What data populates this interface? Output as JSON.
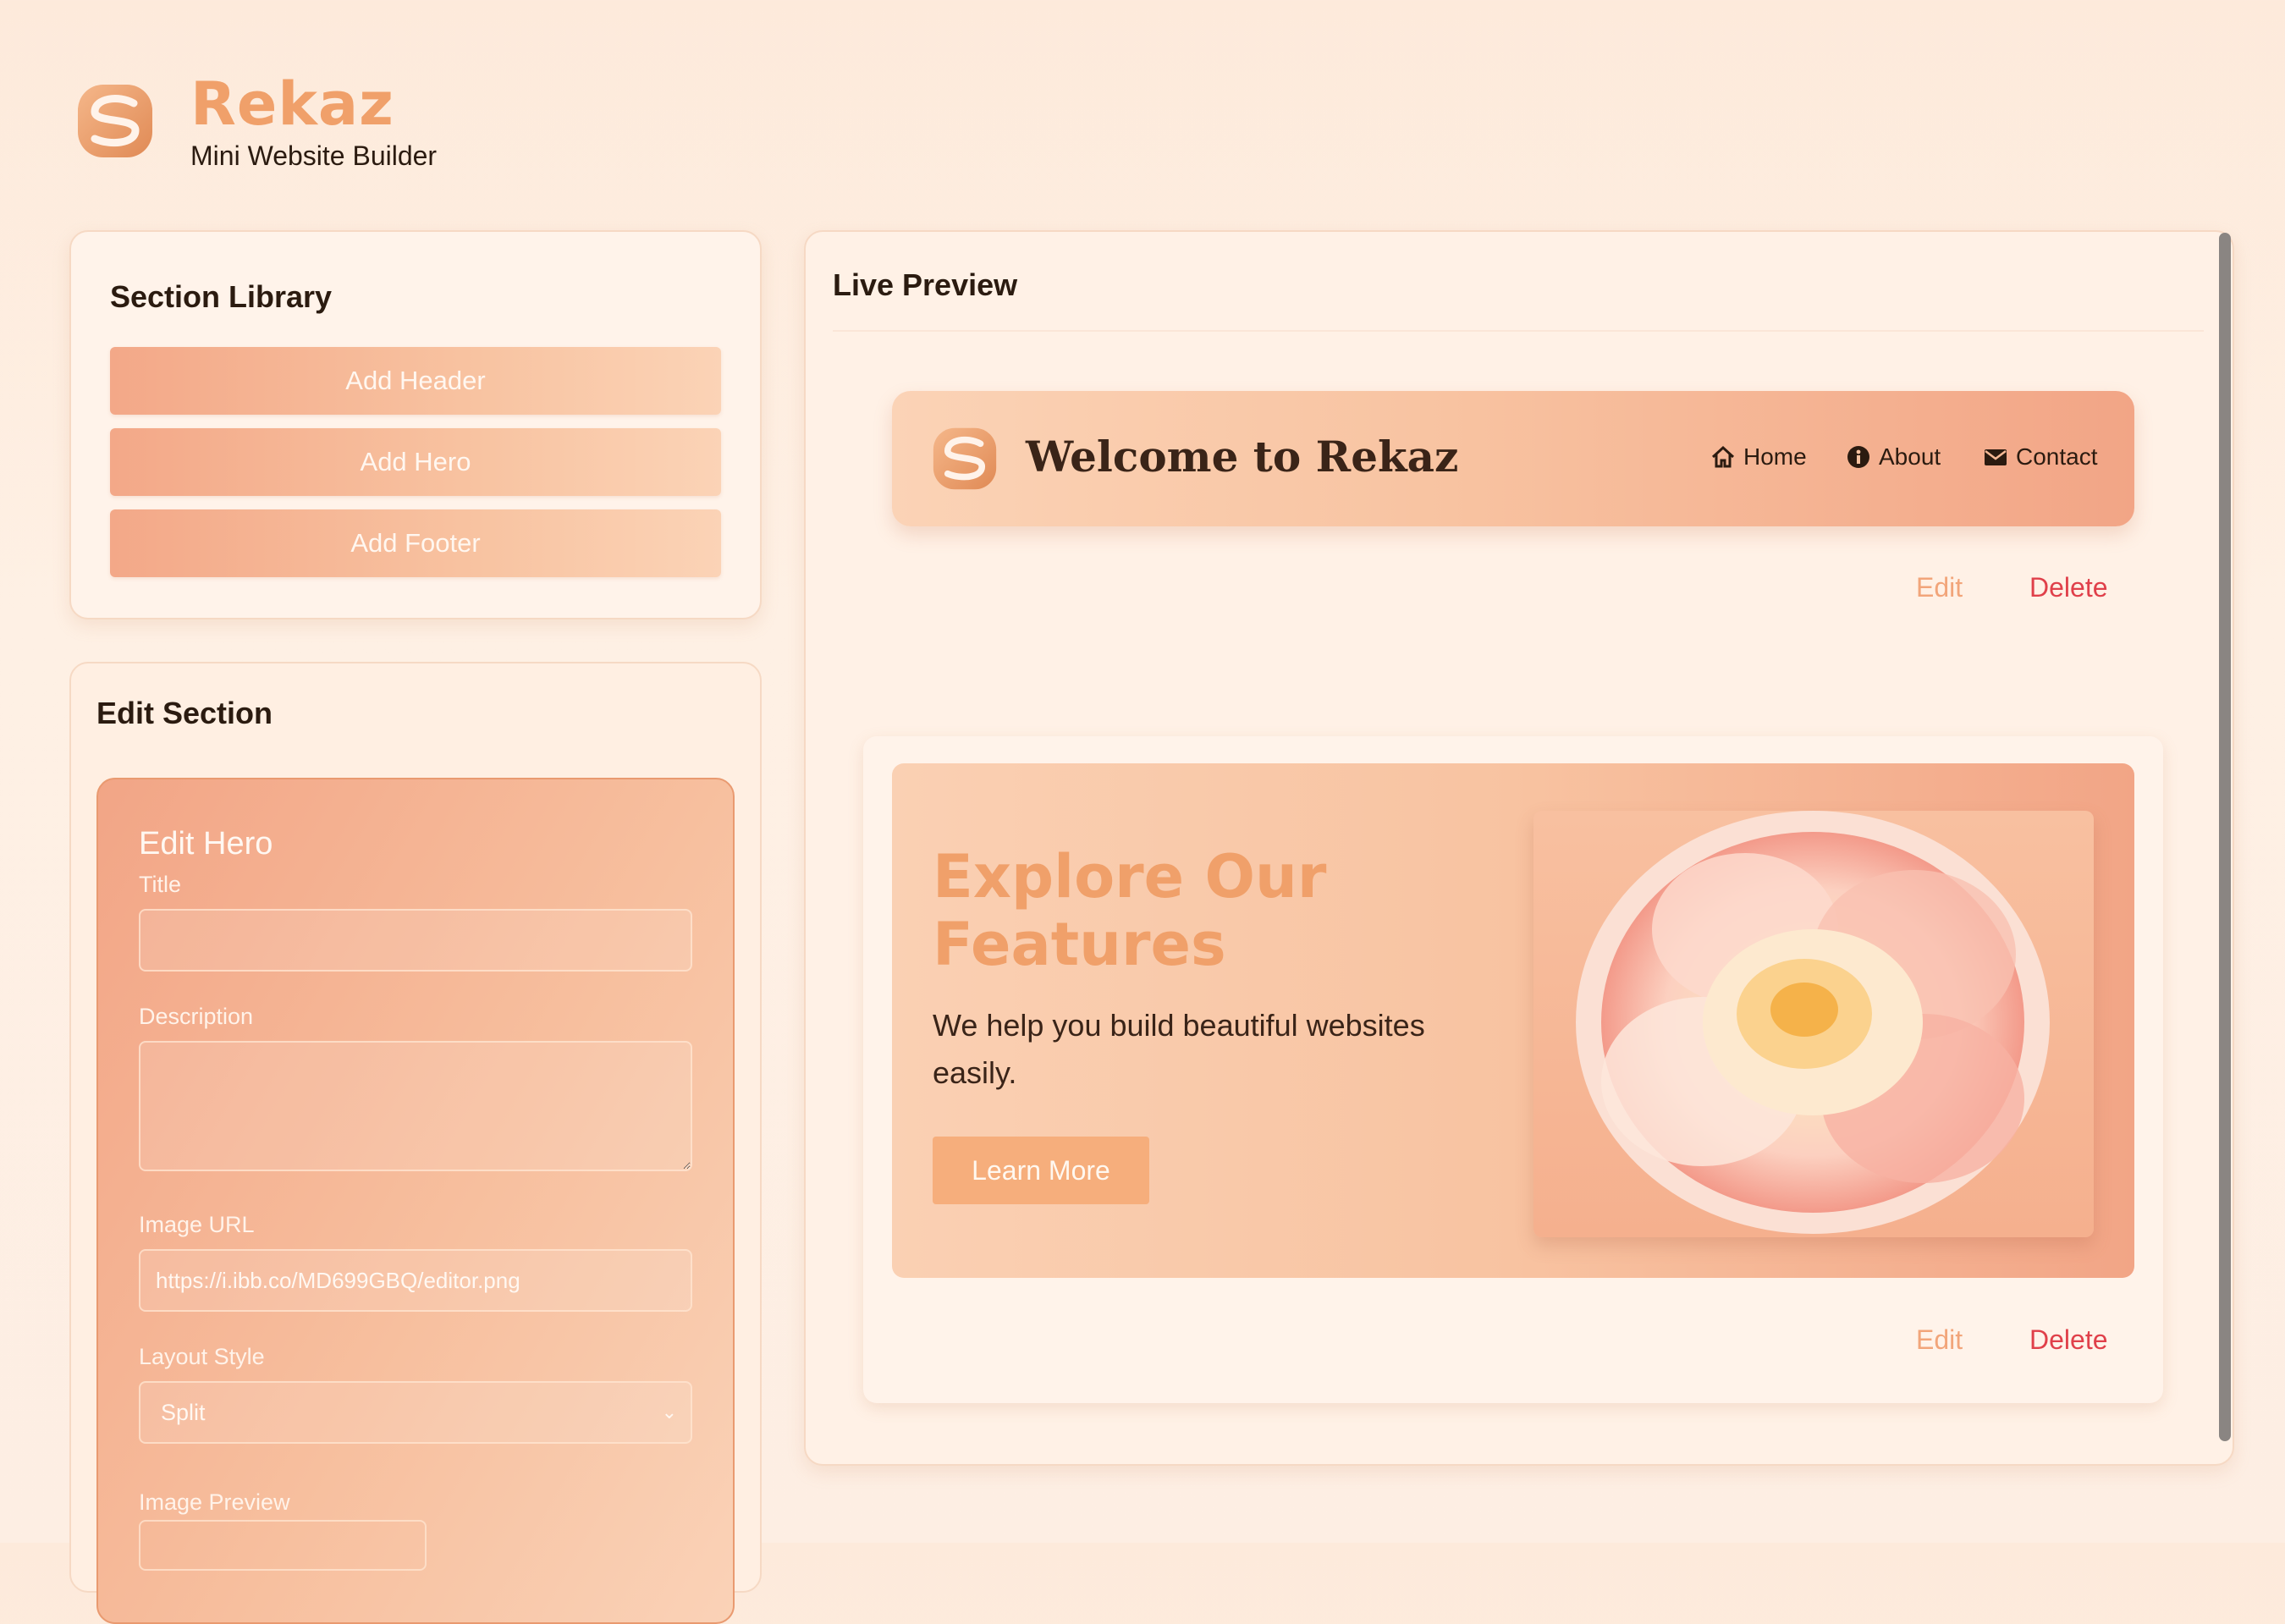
{
  "brand": {
    "name": "Rekaz",
    "subtitle": "Mini Website Builder"
  },
  "library": {
    "title": "Section Library",
    "buttons": [
      "Add Header",
      "Add Hero",
      "Add Footer"
    ]
  },
  "edit": {
    "title": "Edit Section",
    "form_title": "Edit Hero",
    "title_label": "Title",
    "title_value": "",
    "description_label": "Description",
    "description_value": "",
    "image_label": "Image URL",
    "image_value": "https://i.ibb.co/MD699GBQ/editor.png",
    "layout_label": "Layout Style",
    "layout_value": "Split",
    "preview_label": "Image Preview"
  },
  "preview": {
    "title": "Live Preview",
    "header": {
      "title": "Welcome to Rekaz",
      "nav": [
        "Home",
        "About",
        "Contact"
      ]
    },
    "hero": {
      "title": "Explore Our Features",
      "description": "We help you build beautiful websites easily.",
      "button": "Learn More"
    },
    "actions": {
      "edit": "Edit",
      "delete": "Delete"
    }
  },
  "colors": {
    "accent": "#f0a06a",
    "delete": "#e0404a",
    "background": "#fdeadb"
  }
}
